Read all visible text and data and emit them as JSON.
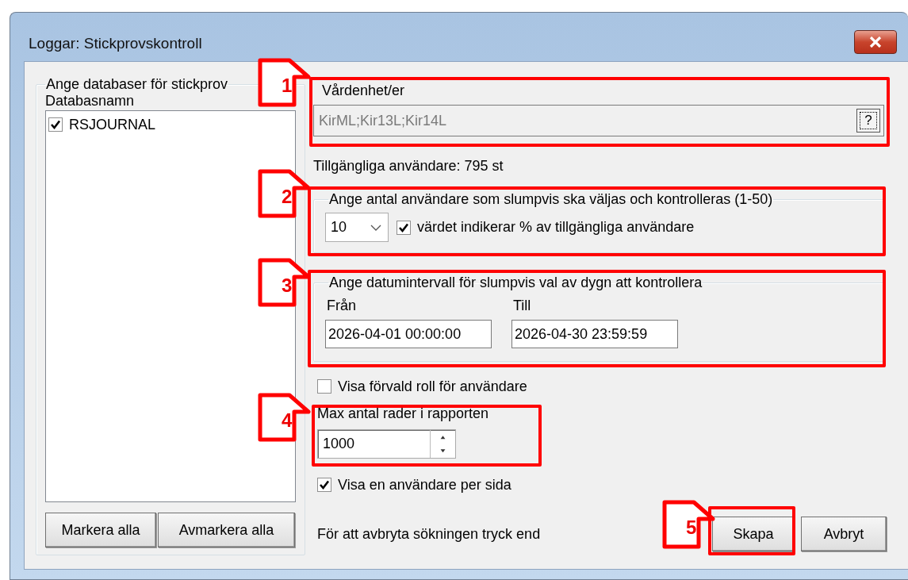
{
  "window": {
    "title": "Loggar: Stickprovskontroll"
  },
  "databases": {
    "legend": "Ange databaser för stickprov",
    "column": "Databasnamn",
    "items": [
      {
        "label": "RSJOURNAL",
        "checked": true
      }
    ],
    "buttons": [
      "Markera alla",
      "Avmarkera alla"
    ]
  },
  "units": {
    "label": "Vårdenhet/er",
    "value": "KirML;Kir13L;Kir14L",
    "disabled": true,
    "lookup_button": "?"
  },
  "available_users": "Tillgängliga användare: 795 st",
  "user_count": {
    "legend": "Ange antal användare som slumpvis ska väljas och kontrolleras (1-50)",
    "value": "10",
    "percent_option": {
      "label": "värdet indikerar % av tillgängliga användare",
      "checked": true
    }
  },
  "date_range": {
    "legend": "Ange datumintervall för slumpvis val av dygn att kontrollera",
    "from_label": "Från",
    "from_value": "2026-04-01 00:00:00",
    "to_label": "Till",
    "to_value": "2026-04-30 23:59:59"
  },
  "show_default_role": {
    "label": "Visa förvald roll för användare",
    "checked": false
  },
  "max_rows": {
    "label": "Max antal rader i rapporten",
    "value": "1000"
  },
  "one_user_per_page": {
    "label": "Visa en användare per sida",
    "checked": true
  },
  "hint": "För att avbryta sökningen tryck end",
  "buttons": [
    "Skapa",
    "Avbryt"
  ],
  "annotations": [
    {
      "number": "1"
    },
    {
      "number": "2"
    },
    {
      "number": "3"
    },
    {
      "number": "4"
    },
    {
      "number": "5"
    }
  ]
}
